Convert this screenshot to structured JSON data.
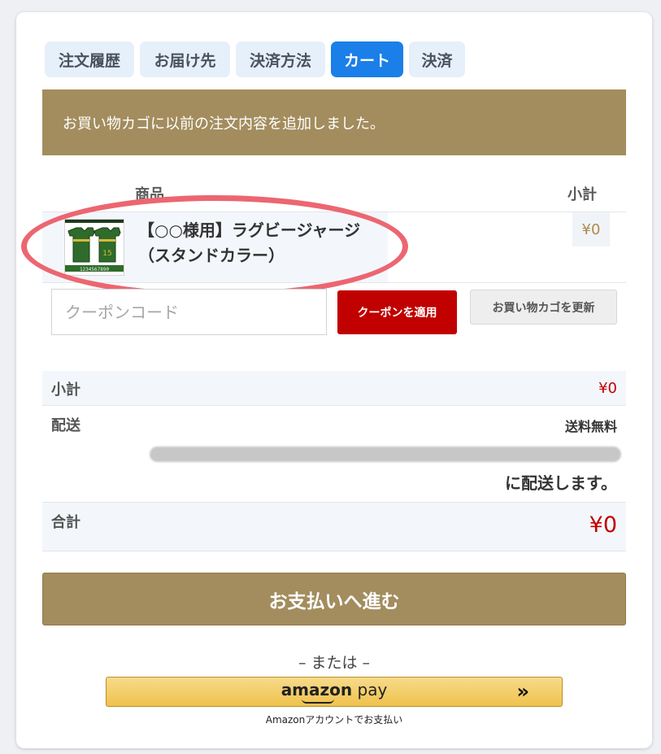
{
  "tabs": [
    {
      "label": "注文履歴",
      "active": false
    },
    {
      "label": "お届け先",
      "active": false
    },
    {
      "label": "決済方法",
      "active": false
    },
    {
      "label": "カート",
      "active": true
    },
    {
      "label": "決済",
      "active": false
    }
  ],
  "notice": "お買い物カゴに以前の注文内容を追加しました。",
  "table": {
    "col_product": "商品",
    "col_subtotal": "小計"
  },
  "item": {
    "name_line1": "【○○様用】ラグビージャージ",
    "name_line2": "（スタンドカラー）",
    "price": "¥0",
    "thumb_text": "1234567890",
    "thumb_number": "15"
  },
  "coupon": {
    "placeholder": "クーポンコード",
    "apply_label": "クーポンを適用",
    "update_label": "お買い物カゴを更新"
  },
  "summary": {
    "subtotal_label": "小計",
    "subtotal_value": "¥0",
    "shipping_label": "配送",
    "shipping_value": "送料無料",
    "shipping_note": "に配送します。",
    "total_label": "合計",
    "total_value": "¥0"
  },
  "checkout_label": "お支払いへ進む",
  "or_text": "– または –",
  "amazon": {
    "logo_bold": "amazon",
    "logo_light": " pay",
    "chevron": "»",
    "caption": "Amazonアカウントでお支払い"
  },
  "colors": {
    "accent": "#a38d5e",
    "active_tab": "#1a7fe8",
    "price_red": "#c10000",
    "highlight_oval": "#ec6671"
  }
}
